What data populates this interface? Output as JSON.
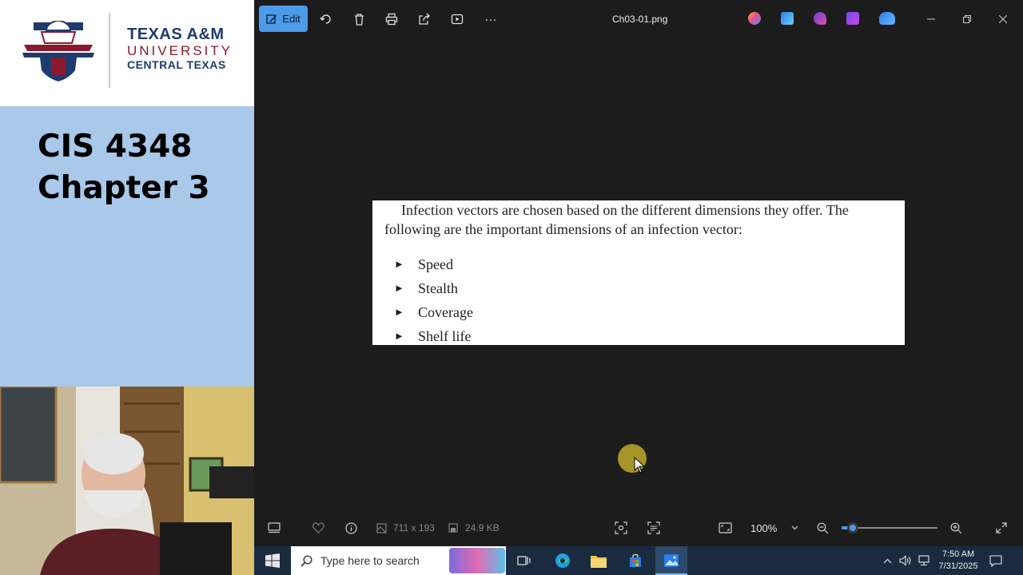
{
  "slide": {
    "logo": {
      "line1": "TEXAS A&M",
      "line2": "UNIVERSITY",
      "line3": "CENTRAL TEXAS"
    },
    "title_line1": "CIS 4348",
    "title_line2": "Chapter 3"
  },
  "viewer": {
    "toolbar": {
      "edit_label": "Edit",
      "icons": [
        "rotate-icon",
        "delete-icon",
        "print-icon",
        "share-icon",
        "slideshow-icon",
        "more-icon"
      ],
      "more_label": "···"
    },
    "title": "Ch03-01.png",
    "image": {
      "paragraph": "Infection vectors are chosen based on the different dimensions they offer. The following are the important dimensions of an infection vector:",
      "bullet_marker": "►",
      "bullets": [
        "Speed",
        "Stealth",
        "Coverage",
        "Shelf life"
      ]
    },
    "status": {
      "dimensions": "711 x 193",
      "file_size": "24.9 KB",
      "zoom": "100%",
      "zoom_level": 0.12
    }
  },
  "taskbar": {
    "search_placeholder": "Type here to search",
    "time": "7:50 AM",
    "date": "7/31/2025"
  },
  "colors": {
    "accent": "#4c9be8",
    "slide_bg": "#a9c8ea",
    "viewer_bg": "#1c1c1c",
    "taskbar_bg": "#1a2b40",
    "brand_navy": "#1f3b6e",
    "brand_maroon": "#8a1a2f"
  }
}
